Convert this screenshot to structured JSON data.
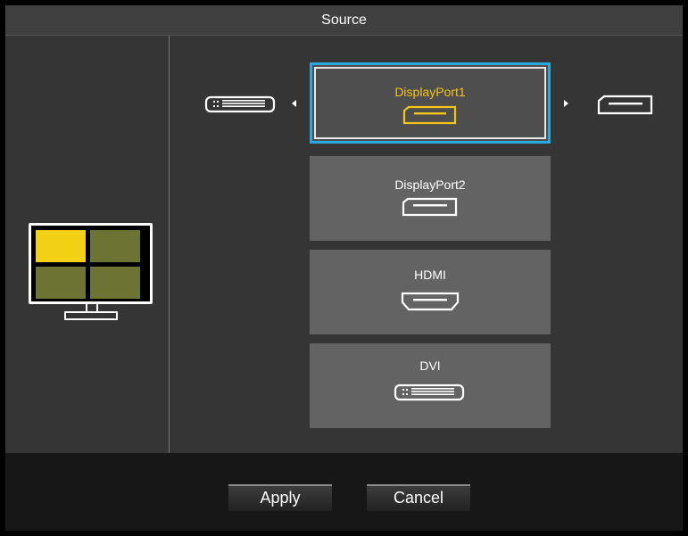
{
  "title": "Source",
  "colors": {
    "selection_border": "#2aa8e0",
    "selected_label": "#f2c318",
    "active_quad": "#f2d016",
    "inactive_quad": "#6d7332"
  },
  "layout_preview": {
    "icon": "monitor-quad-layout-icon",
    "active_quadrant": "top-left"
  },
  "carousel": {
    "left_icon": "dvi-port-icon",
    "right_icon": "displayport-port-icon"
  },
  "sources": [
    {
      "label": "DisplayPort1",
      "icon": "displayport-icon",
      "selected": true
    },
    {
      "label": "DisplayPort2",
      "icon": "displayport-icon",
      "selected": false
    },
    {
      "label": "HDMI",
      "icon": "hdmi-icon",
      "selected": false
    },
    {
      "label": "DVI",
      "icon": "dvi-icon",
      "selected": false
    }
  ],
  "buttons": {
    "apply": "Apply",
    "cancel": "Cancel"
  }
}
